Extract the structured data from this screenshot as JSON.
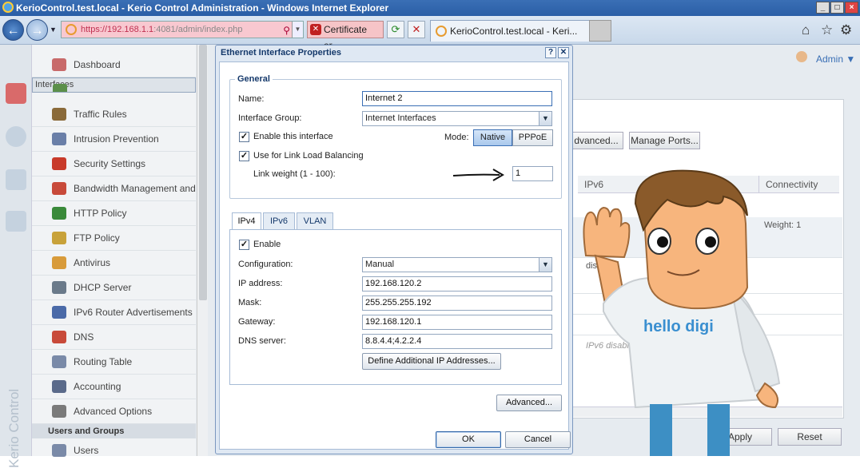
{
  "window": {
    "title": "KerioControl.test.local - Kerio Control Administration - Windows Internet Explorer"
  },
  "browser": {
    "address_host": "https://192.168.1.1",
    "address_path": ":4081/admin/index.php",
    "cert_label": "Certificate er...",
    "tab_label": "KerioControl.test.local - Keri..."
  },
  "rail": {
    "brand": "Kerio Control"
  },
  "sidebar": {
    "items": [
      {
        "label": "Dashboard",
        "icon": "dashboard-icon",
        "color": "#c86a6a"
      },
      {
        "label": "Interfaces",
        "icon": "network-card-icon",
        "color": "#5b8f4a"
      },
      {
        "label": "Traffic Rules",
        "icon": "traffic-rules-icon",
        "color": "#8a6a3a"
      },
      {
        "label": "Intrusion Prevention",
        "icon": "shield-icon",
        "color": "#6a7fa8"
      },
      {
        "label": "Security Settings",
        "icon": "stop-hand-icon",
        "color": "#c83a2a"
      },
      {
        "label": "Bandwidth Management and",
        "icon": "bandwidth-icon",
        "color": "#c84a3a"
      },
      {
        "label": "HTTP Policy",
        "icon": "http-policy-icon",
        "color": "#3a8a3a"
      },
      {
        "label": "FTP Policy",
        "icon": "ftp-policy-icon",
        "color": "#c8a23a"
      },
      {
        "label": "Antivirus",
        "icon": "antivirus-icon",
        "color": "#d89b3a"
      },
      {
        "label": "DHCP Server",
        "icon": "dhcp-server-icon",
        "color": "#6a7a8a"
      },
      {
        "label": "IPv6 Router Advertisements",
        "icon": "ipv6-router-icon",
        "color": "#4a6aa8"
      },
      {
        "label": "DNS",
        "icon": "dns-icon",
        "color": "#c84a3a"
      },
      {
        "label": "Routing Table",
        "icon": "routing-table-icon",
        "color": "#7a8aa8"
      },
      {
        "label": "Accounting",
        "icon": "accounting-icon",
        "color": "#5a6a8a"
      },
      {
        "label": "Advanced Options",
        "icon": "advanced-options-icon",
        "color": "#7a7a7a"
      }
    ],
    "group_label": "Users and Groups",
    "partial_item": "Users"
  },
  "header": {
    "user": "Admin"
  },
  "background": {
    "advanced_button": "dvanced...",
    "manage_ports_button": "Manage Ports...",
    "col_ipv6": "IPv6",
    "col_connectivity": "Connectivity",
    "row1_ipv6": "disable",
    "row1_conn": "Weight: 1",
    "row2_ipv6": "disabled",
    "row3_ipv6": "IPv6 disabled",
    "apply": "Apply",
    "reset": "Reset"
  },
  "dialog": {
    "title": "Ethernet Interface Properties",
    "general_legend": "General",
    "name_label": "Name:",
    "name_value": "Internet 2",
    "group_label": "Interface Group:",
    "group_value": "Internet Interfaces",
    "enable_label": "Enable this interface",
    "enable_checked": true,
    "lb_label": "Use for Link Load Balancing",
    "lb_checked": true,
    "mode_label": "Mode:",
    "mode_native": "Native",
    "mode_pppoe": "PPPoE",
    "mode_selected": "Native",
    "weight_label": "Link weight (1 - 100):",
    "weight_value": "1",
    "tabs": [
      "IPv4",
      "IPv6",
      "VLAN"
    ],
    "active_tab": "IPv4",
    "ipv4": {
      "enable_label": "Enable",
      "enable_checked": true,
      "config_label": "Configuration:",
      "config_value": "Manual",
      "ip_label": "IP address:",
      "ip_value": "192.168.120.2",
      "mask_label": "Mask:",
      "mask_value": "255.255.255.192",
      "gw_label": "Gateway:",
      "gw_value": "192.168.120.1",
      "dns_label": "DNS server:",
      "dns_value": "8.8.4.4;4.2.2.4",
      "define_button": "Define Additional IP Addresses..."
    },
    "advanced_button": "Advanced...",
    "ok_button": "OK",
    "cancel_button": "Cancel"
  },
  "mascot": {
    "shirt_text": "hello digi"
  }
}
